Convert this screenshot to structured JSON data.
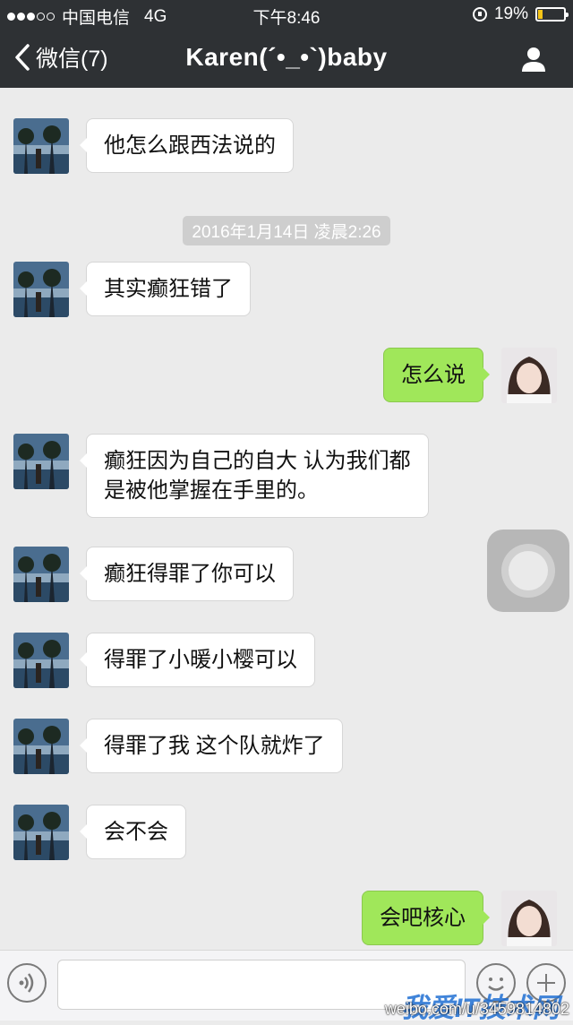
{
  "status_bar": {
    "carrier": "中国电信",
    "network": "4G",
    "time": "下午8:46",
    "battery": "19%",
    "battery_level": 0.19,
    "signal_bars_filled": 3,
    "signal_bars_total": 5
  },
  "nav": {
    "back_label": "微信(7)",
    "title": "Karen(´•_•`)baby",
    "back_icon": "chevron-left-icon",
    "profile_icon": "person-icon"
  },
  "chat": {
    "messages": [
      {
        "side": "in",
        "text": "他怎么跟西法说的"
      },
      {
        "side": "in",
        "text": "其实癫狂错了"
      },
      {
        "side": "out",
        "text": "怎么说"
      },
      {
        "side": "in",
        "text": "癫狂因为自己的自大 认为我们都\n是被他掌握在手里的。"
      },
      {
        "side": "in",
        "text": "癫狂得罪了你可以"
      },
      {
        "side": "in",
        "text": "得罪了小暖小樱可以"
      },
      {
        "side": "in",
        "text": "得罪了我 这个队就炸了"
      },
      {
        "side": "in",
        "text": "会不会"
      },
      {
        "side": "out",
        "text": "会吧核心"
      }
    ],
    "timestamp": "2016年1月14日 凌晨2:26"
  },
  "input_bar": {
    "voice_icon": "voice-icon",
    "emoji_icon": "emoji-icon",
    "plus_icon": "plus-icon"
  },
  "watermark": {
    "logo_text": "我爱IT技术网",
    "url": "weibo.com/u/3459814802"
  },
  "colors": {
    "header_bg": "#2e3134",
    "chat_bg": "#ebebeb",
    "out_bubble": "#a0e75a",
    "in_bubble": "#ffffff"
  }
}
